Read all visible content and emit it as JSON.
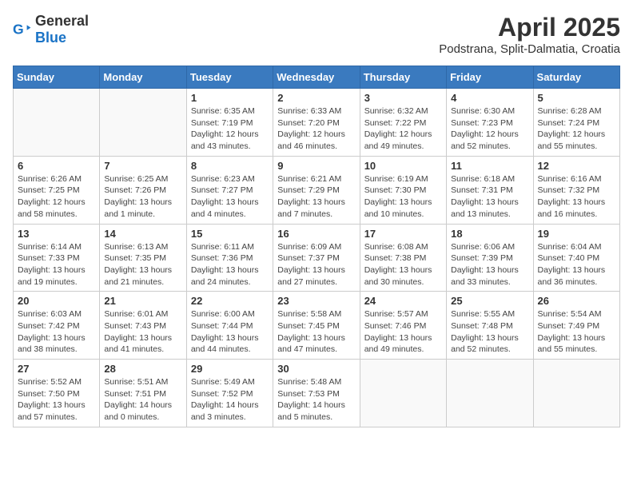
{
  "header": {
    "logo_general": "General",
    "logo_blue": "Blue",
    "title": "April 2025",
    "subtitle": "Podstrana, Split-Dalmatia, Croatia"
  },
  "weekdays": [
    "Sunday",
    "Monday",
    "Tuesday",
    "Wednesday",
    "Thursday",
    "Friday",
    "Saturday"
  ],
  "weeks": [
    [
      {
        "day": "",
        "info": ""
      },
      {
        "day": "",
        "info": ""
      },
      {
        "day": "1",
        "info": "Sunrise: 6:35 AM\nSunset: 7:19 PM\nDaylight: 12 hours and 43 minutes."
      },
      {
        "day": "2",
        "info": "Sunrise: 6:33 AM\nSunset: 7:20 PM\nDaylight: 12 hours and 46 minutes."
      },
      {
        "day": "3",
        "info": "Sunrise: 6:32 AM\nSunset: 7:22 PM\nDaylight: 12 hours and 49 minutes."
      },
      {
        "day": "4",
        "info": "Sunrise: 6:30 AM\nSunset: 7:23 PM\nDaylight: 12 hours and 52 minutes."
      },
      {
        "day": "5",
        "info": "Sunrise: 6:28 AM\nSunset: 7:24 PM\nDaylight: 12 hours and 55 minutes."
      }
    ],
    [
      {
        "day": "6",
        "info": "Sunrise: 6:26 AM\nSunset: 7:25 PM\nDaylight: 12 hours and 58 minutes."
      },
      {
        "day": "7",
        "info": "Sunrise: 6:25 AM\nSunset: 7:26 PM\nDaylight: 13 hours and 1 minute."
      },
      {
        "day": "8",
        "info": "Sunrise: 6:23 AM\nSunset: 7:27 PM\nDaylight: 13 hours and 4 minutes."
      },
      {
        "day": "9",
        "info": "Sunrise: 6:21 AM\nSunset: 7:29 PM\nDaylight: 13 hours and 7 minutes."
      },
      {
        "day": "10",
        "info": "Sunrise: 6:19 AM\nSunset: 7:30 PM\nDaylight: 13 hours and 10 minutes."
      },
      {
        "day": "11",
        "info": "Sunrise: 6:18 AM\nSunset: 7:31 PM\nDaylight: 13 hours and 13 minutes."
      },
      {
        "day": "12",
        "info": "Sunrise: 6:16 AM\nSunset: 7:32 PM\nDaylight: 13 hours and 16 minutes."
      }
    ],
    [
      {
        "day": "13",
        "info": "Sunrise: 6:14 AM\nSunset: 7:33 PM\nDaylight: 13 hours and 19 minutes."
      },
      {
        "day": "14",
        "info": "Sunrise: 6:13 AM\nSunset: 7:35 PM\nDaylight: 13 hours and 21 minutes."
      },
      {
        "day": "15",
        "info": "Sunrise: 6:11 AM\nSunset: 7:36 PM\nDaylight: 13 hours and 24 minutes."
      },
      {
        "day": "16",
        "info": "Sunrise: 6:09 AM\nSunset: 7:37 PM\nDaylight: 13 hours and 27 minutes."
      },
      {
        "day": "17",
        "info": "Sunrise: 6:08 AM\nSunset: 7:38 PM\nDaylight: 13 hours and 30 minutes."
      },
      {
        "day": "18",
        "info": "Sunrise: 6:06 AM\nSunset: 7:39 PM\nDaylight: 13 hours and 33 minutes."
      },
      {
        "day": "19",
        "info": "Sunrise: 6:04 AM\nSunset: 7:40 PM\nDaylight: 13 hours and 36 minutes."
      }
    ],
    [
      {
        "day": "20",
        "info": "Sunrise: 6:03 AM\nSunset: 7:42 PM\nDaylight: 13 hours and 38 minutes."
      },
      {
        "day": "21",
        "info": "Sunrise: 6:01 AM\nSunset: 7:43 PM\nDaylight: 13 hours and 41 minutes."
      },
      {
        "day": "22",
        "info": "Sunrise: 6:00 AM\nSunset: 7:44 PM\nDaylight: 13 hours and 44 minutes."
      },
      {
        "day": "23",
        "info": "Sunrise: 5:58 AM\nSunset: 7:45 PM\nDaylight: 13 hours and 47 minutes."
      },
      {
        "day": "24",
        "info": "Sunrise: 5:57 AM\nSunset: 7:46 PM\nDaylight: 13 hours and 49 minutes."
      },
      {
        "day": "25",
        "info": "Sunrise: 5:55 AM\nSunset: 7:48 PM\nDaylight: 13 hours and 52 minutes."
      },
      {
        "day": "26",
        "info": "Sunrise: 5:54 AM\nSunset: 7:49 PM\nDaylight: 13 hours and 55 minutes."
      }
    ],
    [
      {
        "day": "27",
        "info": "Sunrise: 5:52 AM\nSunset: 7:50 PM\nDaylight: 13 hours and 57 minutes."
      },
      {
        "day": "28",
        "info": "Sunrise: 5:51 AM\nSunset: 7:51 PM\nDaylight: 14 hours and 0 minutes."
      },
      {
        "day": "29",
        "info": "Sunrise: 5:49 AM\nSunset: 7:52 PM\nDaylight: 14 hours and 3 minutes."
      },
      {
        "day": "30",
        "info": "Sunrise: 5:48 AM\nSunset: 7:53 PM\nDaylight: 14 hours and 5 minutes."
      },
      {
        "day": "",
        "info": ""
      },
      {
        "day": "",
        "info": ""
      },
      {
        "day": "",
        "info": ""
      }
    ]
  ]
}
